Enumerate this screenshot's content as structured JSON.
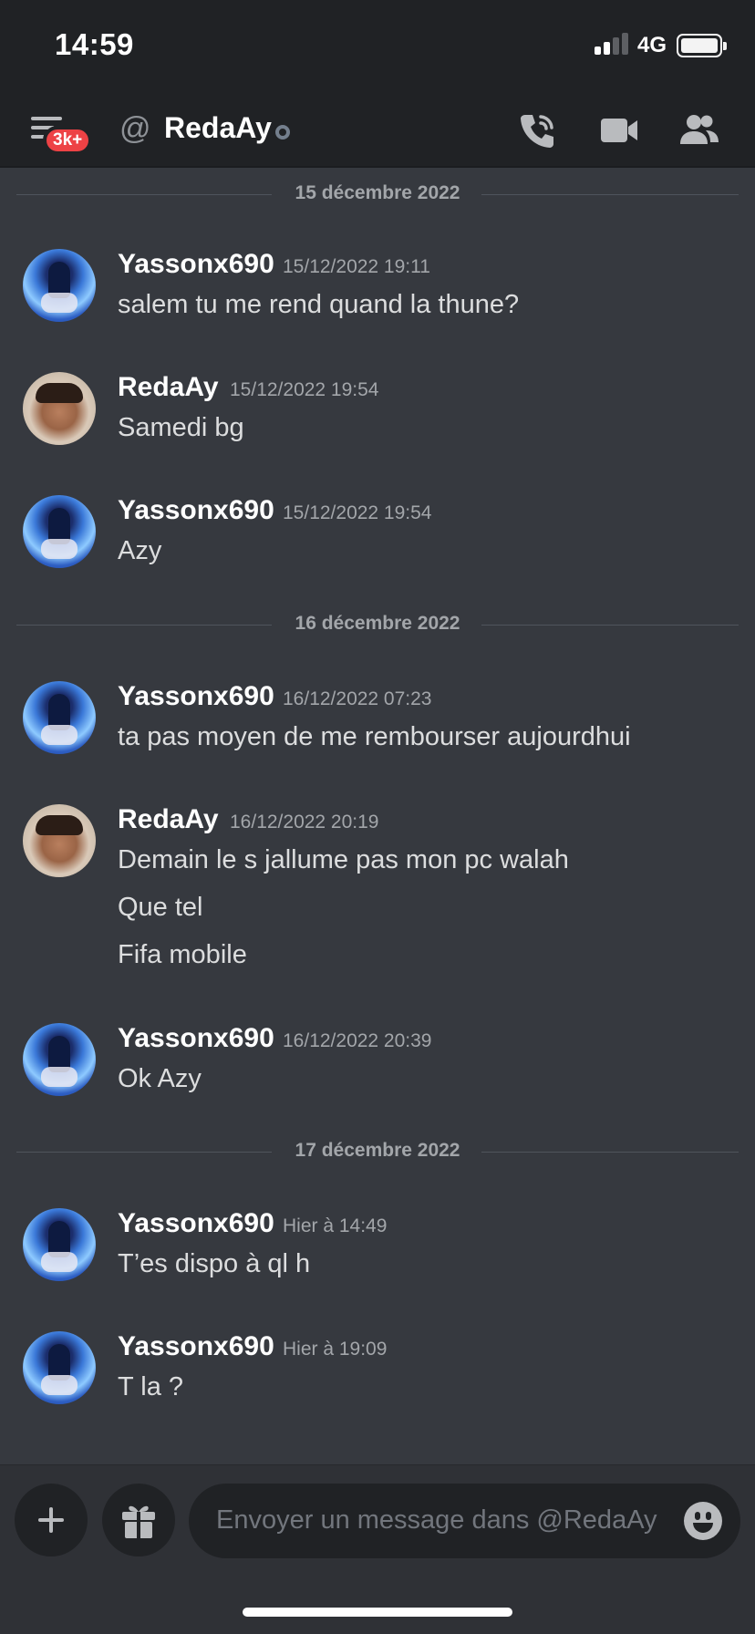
{
  "status_bar": {
    "time": "14:59",
    "network": "4G"
  },
  "header": {
    "badge": "3k+",
    "at_symbol": "@",
    "channel_name": "RedaAy",
    "icons": [
      "menu-icon",
      "at-icon",
      "phone-call-icon",
      "video-camera-icon",
      "members-icon"
    ]
  },
  "dividers": [
    "15 décembre 2022",
    "16 décembre 2022",
    "17 décembre 2022"
  ],
  "messages": [
    {
      "author": "Yassonx690",
      "time": "15/12/2022 19:11",
      "lines": [
        "salem tu me rend quand la thune?"
      ]
    },
    {
      "author": "RedaAy",
      "time": "15/12/2022 19:54",
      "lines": [
        "Samedi bg"
      ]
    },
    {
      "author": "Yassonx690",
      "time": "15/12/2022 19:54",
      "lines": [
        "Azy"
      ]
    },
    {
      "author": "Yassonx690",
      "time": "16/12/2022 07:23",
      "lines": [
        "ta pas moyen de me rembourser aujourdhui"
      ]
    },
    {
      "author": "RedaAy",
      "time": "16/12/2022 20:19",
      "lines": [
        "Demain le s jallume pas mon pc walah",
        "Que tel",
        "Fifa mobile"
      ]
    },
    {
      "author": "Yassonx690",
      "time": "16/12/2022 20:39",
      "lines": [
        "Ok Azy"
      ]
    },
    {
      "author": "Yassonx690",
      "time": "Hier à 14:49",
      "lines": [
        "T’es dispo à ql h"
      ]
    },
    {
      "author": "Yassonx690",
      "time": "Hier à 19:09",
      "lines": [
        "T la ?"
      ]
    }
  ],
  "composer": {
    "placeholder": "Envoyer un message dans @RedaAy",
    "icons": [
      "plus-icon",
      "gift-icon",
      "emoji-icon"
    ]
  },
  "colors": {
    "background": "#36393f",
    "header": "#202225",
    "badge": "#ed4245",
    "text": "#dcddde",
    "muted": "#a3a6aa"
  }
}
